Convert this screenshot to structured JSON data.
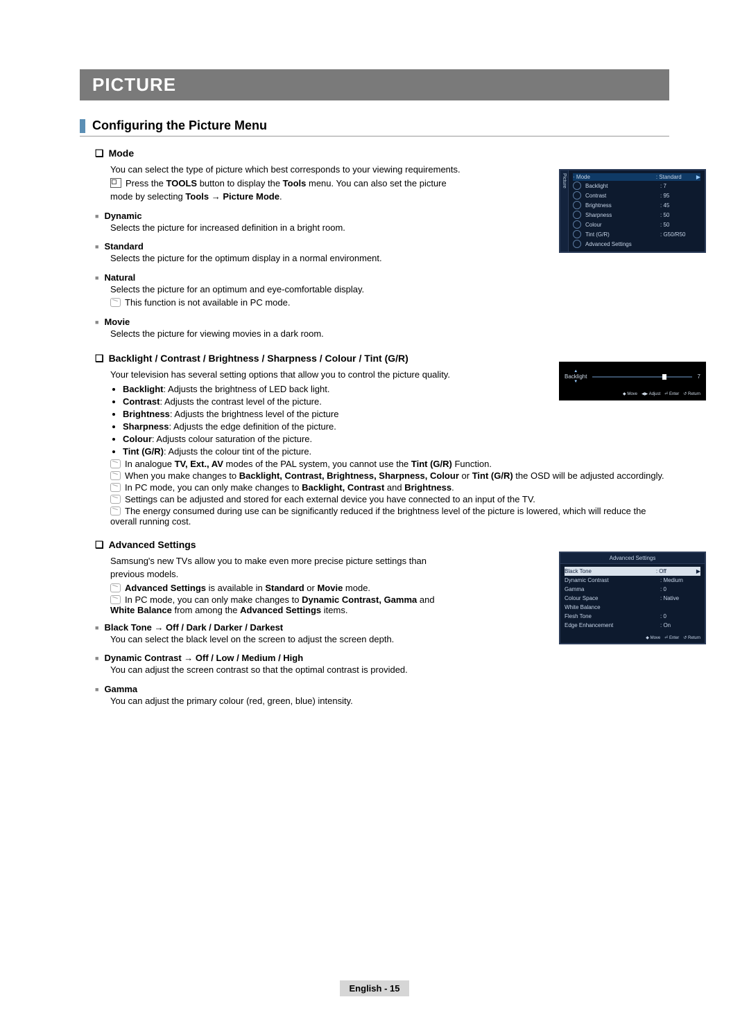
{
  "header": "PICTURE",
  "subsection": "Configuring the Picture Menu",
  "mode": {
    "title": "Mode",
    "intro": "You can select the type of picture which best corresponds to your viewing requirements.",
    "tool_prefix": "Press the ",
    "tool_bold": "TOOLS",
    "tool_mid": " button to display the ",
    "tool_bold2": "Tools",
    "tool_suffix": " menu. You can also set the picture mode by selecting ",
    "tool_path": "Tools → Picture Mode",
    "dynamic": {
      "name": "Dynamic",
      "desc": "Selects the picture for increased definition in a bright room."
    },
    "standard": {
      "name": "Standard",
      "desc": "Selects the picture for the optimum display in a normal environment."
    },
    "natural": {
      "name": "Natural",
      "desc": "Selects the picture for an optimum and eye-comfortable display.",
      "note": "This function is not available in PC mode."
    },
    "movie": {
      "name": "Movie",
      "desc": "Selects the picture for viewing movies in a dark room."
    }
  },
  "settings": {
    "title": "Backlight / Contrast / Brightness / Sharpness / Colour / Tint (G/R)",
    "intro": "Your television has several setting options that allow you to control the picture quality.",
    "bullets": [
      {
        "b": "Backlight",
        "t": ": Adjusts the brightness of LED back light."
      },
      {
        "b": "Contrast",
        "t": ": Adjusts the contrast level of the picture."
      },
      {
        "b": "Brightness",
        "t": ": Adjusts the brightness level of the picture"
      },
      {
        "b": "Sharpness",
        "t": ": Adjusts the edge definition of the picture."
      },
      {
        "b": "Colour",
        "t": ": Adjusts colour saturation of the picture."
      },
      {
        "b": "Tint (G/R)",
        "t": ": Adjusts the colour tint of the picture."
      }
    ],
    "notes": [
      {
        "pre": "In analogue ",
        "b1": "TV, Ext., AV",
        "mid": " modes of the PAL system, you cannot use the ",
        "b2": "Tint (G/R)",
        "post": " Function."
      },
      {
        "pre": "When you make changes to ",
        "b1": "Backlight, Contrast, Brightness, Sharpness, Colour",
        "mid": " or ",
        "b2": "Tint (G/R)",
        "post": " the OSD will be adjusted accordingly."
      },
      {
        "pre": "In PC mode, you can only make changes to ",
        "b1": "Backlight, Contrast",
        "mid": " and ",
        "b2": "Brightness",
        "post": "."
      },
      {
        "pre": "",
        "b1": "",
        "mid": "Settings can be adjusted and stored for each external device you have connected to an input of the TV.",
        "b2": "",
        "post": ""
      },
      {
        "pre": "",
        "b1": "",
        "mid": "The energy consumed during use can be significantly reduced if the brightness level of the picture is lowered, which will reduce the overall running cost.",
        "b2": "",
        "post": ""
      }
    ]
  },
  "advanced": {
    "title": "Advanced Settings",
    "intro": "Samsung's new TVs allow you to make even more precise picture settings than previous models.",
    "notes": [
      {
        "pre": "",
        "b1": "Advanced Settings",
        "mid": " is available in ",
        "b2": "Standard",
        "mid2": " or ",
        "b3": "Movie",
        "post": " mode."
      },
      {
        "pre": "In PC mode, you can only make changes to ",
        "b1": "Dynamic Contrast, Gamma",
        "mid": " and ",
        "b2": "White Balance",
        "post": " from among the ",
        "b3": "Advanced Settings",
        "post2": " items."
      }
    ],
    "black": {
      "name": "Black Tone → Off / Dark / Darker / Darkest",
      "desc": "You can select the black level on the screen to adjust the screen depth."
    },
    "dyncontrast": {
      "name": "Dynamic Contrast → Off / Low / Medium / High",
      "desc": "You can adjust the screen contrast so that the optimal contrast is provided."
    },
    "gamma": {
      "name": "Gamma",
      "desc": "You can adjust the primary colour (red, green, blue) intensity."
    }
  },
  "osd1": {
    "tab": "Picture",
    "rows": [
      {
        "l": "Mode",
        "v": ": Standard",
        "sel": true,
        "prefix": "·",
        "arrow": "▶"
      },
      {
        "l": "Backlight",
        "v": ": 7"
      },
      {
        "l": "Contrast",
        "v": ": 95"
      },
      {
        "l": "Brightness",
        "v": ": 45"
      },
      {
        "l": "Sharpness",
        "v": ": 50"
      },
      {
        "l": "Colour",
        "v": ": 50"
      },
      {
        "l": "Tint (G/R)",
        "v": ": G50/R50"
      },
      {
        "l": "Advanced Settings",
        "v": ""
      }
    ]
  },
  "osd2": {
    "label": "Backlight",
    "value": "7",
    "legend": [
      "◆ Move",
      "◀▶ Adjust",
      "⏎ Enter",
      "↺ Return"
    ]
  },
  "osd3": {
    "title": "Advanced Settings",
    "rows": [
      {
        "l": "Black Tone",
        "v": ": Off",
        "sel": true,
        "arrow": "▶"
      },
      {
        "l": "Dynamic Contrast",
        "v": ": Medium"
      },
      {
        "l": "Gamma",
        "v": ": 0"
      },
      {
        "l": "Colour Space",
        "v": ": Native"
      },
      {
        "l": "White Balance",
        "v": ""
      },
      {
        "l": "Flesh Tone",
        "v": ": 0"
      },
      {
        "l": "Edge Enhancement",
        "v": ": On"
      }
    ],
    "legend": [
      "◆ Move",
      "⏎ Enter",
      "↺ Return"
    ]
  },
  "footer": {
    "lang": "English - 15"
  }
}
